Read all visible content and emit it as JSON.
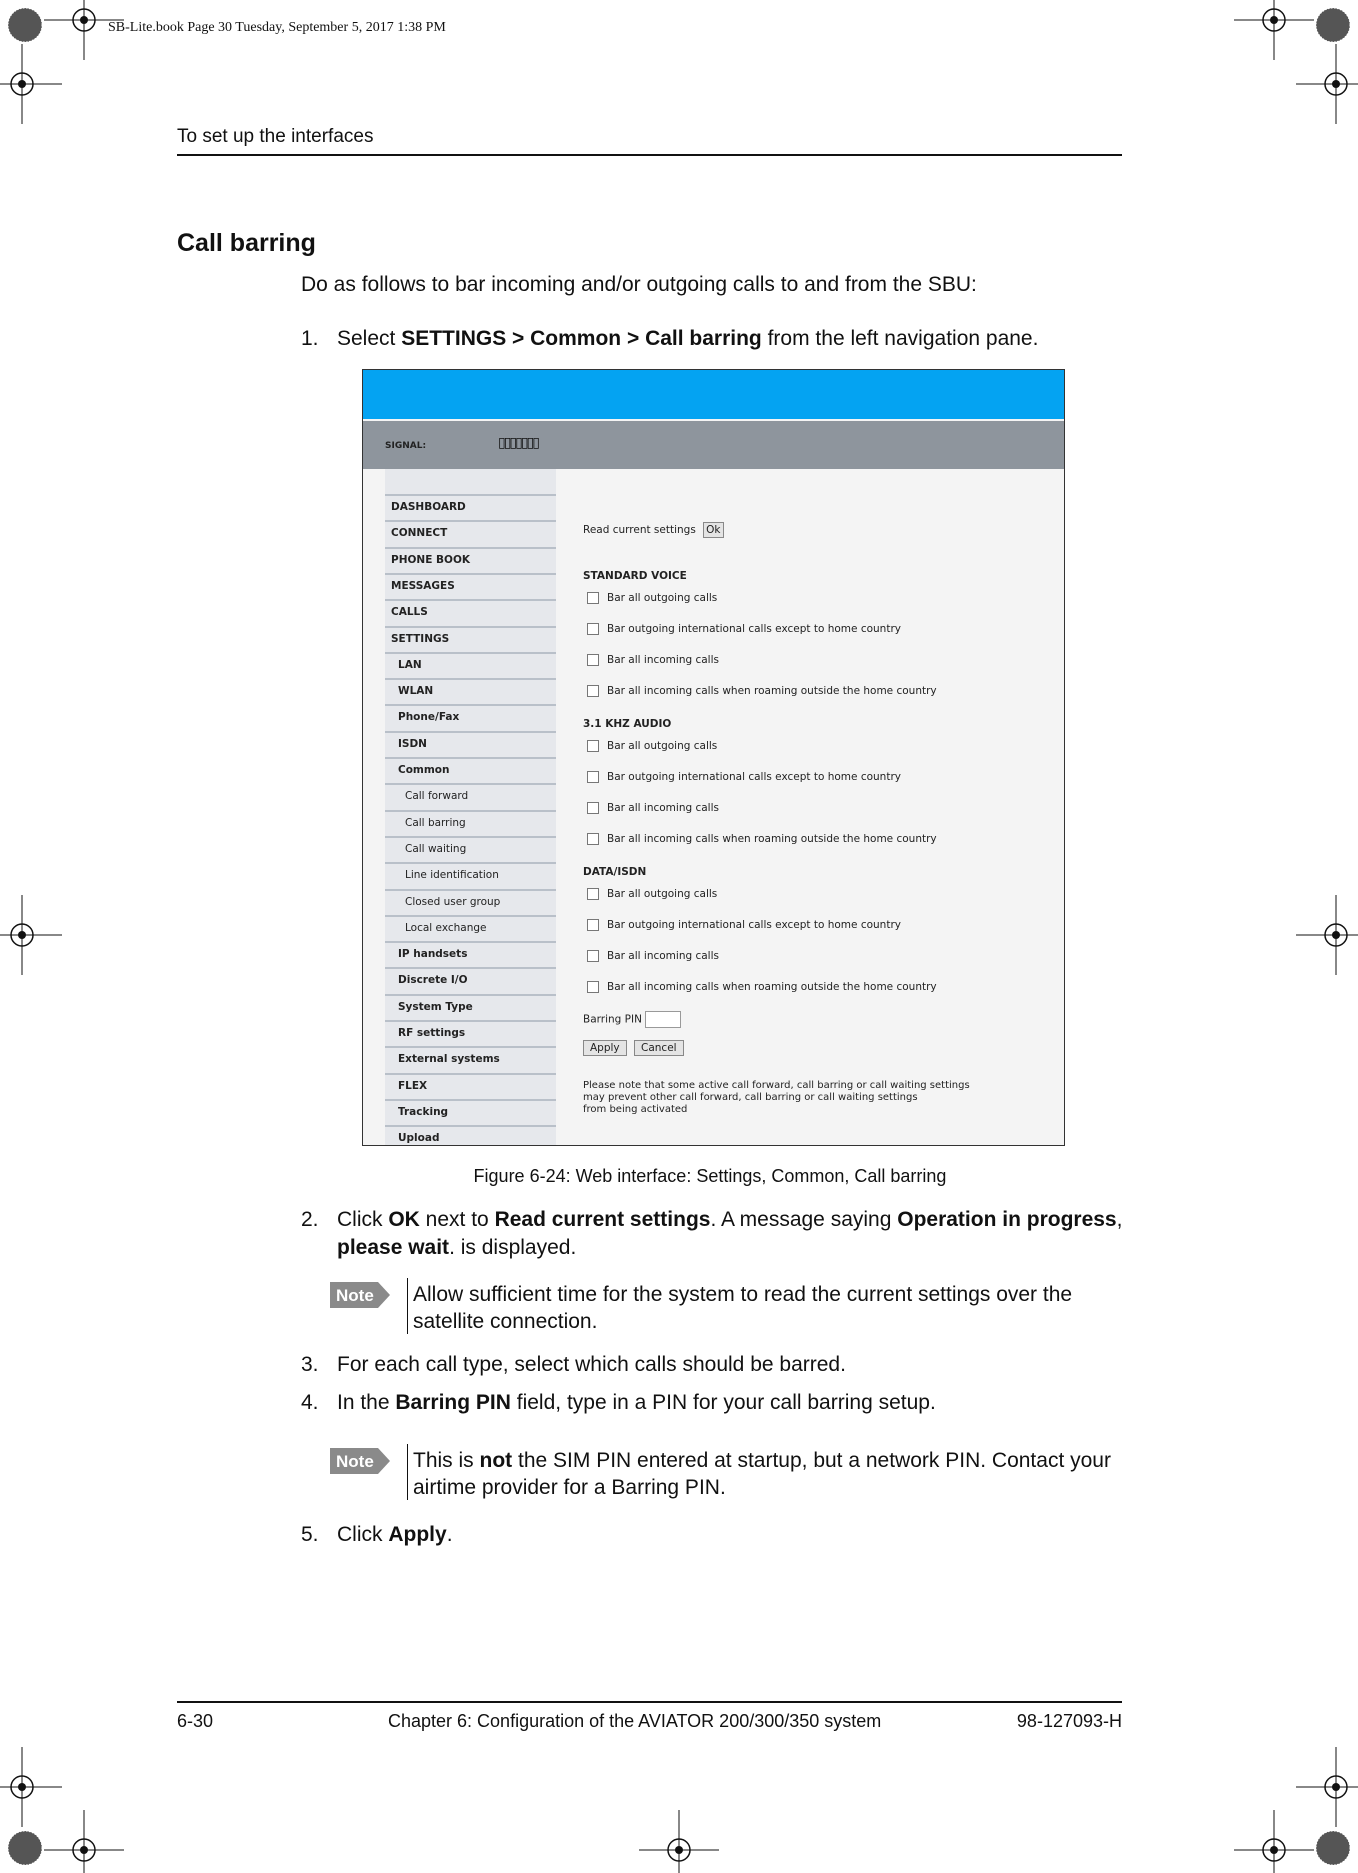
{
  "print_header": "SB-Lite.book  Page 30  Tuesday, September 5, 2017  1:38 PM",
  "running_head": "To set up the interfaces",
  "section_title": "Call barring",
  "intro": "Do as follows to bar incoming and/or outgoing calls to and from the SBU:",
  "steps": {
    "s1": {
      "num": "1.",
      "pre": "Select ",
      "b1": "SETTINGS > Common > Call barring",
      "post": " from the left navigation pane."
    },
    "s2": {
      "num": "2.",
      "pre": "Click ",
      "b1": "OK",
      "mid1": " next to ",
      "b2": "Read current settings",
      "mid2": ". A message saying ",
      "b3": "Operation in progress",
      "mid3": ",",
      "b4": "please wait",
      "post": ". is displayed."
    },
    "s3": {
      "num": "3.",
      "text": "For each call type, select which calls should be barred."
    },
    "s4": {
      "num": "4.",
      "pre": "In the ",
      "b1": "Barring PIN",
      "post": " field, type in a PIN for your call barring setup."
    },
    "s5": {
      "num": "5.",
      "pre": "Click ",
      "b1": "Apply",
      "post": "."
    }
  },
  "notes": {
    "label": "Note",
    "n1": {
      "line1": "Allow sufficient time for the system to read the current settings over the",
      "line2": "satellite connection."
    },
    "n2": {
      "pre": "This is ",
      "b1": "not",
      "post": " the SIM PIN entered at startup, but a network PIN. Contact your",
      "line2": "airtime provider for a Barring PIN."
    }
  },
  "figure": {
    "caption": "Figure 6-24: Web interface: Settings, Common, Call barring",
    "signal_label": "SIGNAL:",
    "signal_bars": "▯▯▯▯▯▯▯",
    "colors": {
      "header": "#04a3f2",
      "statusbar": "#8e959d"
    },
    "nav": [
      {
        "label": "DASHBOARD",
        "level": 0
      },
      {
        "label": "CONNECT",
        "level": 0
      },
      {
        "label": "PHONE BOOK",
        "level": 0
      },
      {
        "label": "MESSAGES",
        "level": 0
      },
      {
        "label": "CALLS",
        "level": 0
      },
      {
        "label": "SETTINGS",
        "level": 0
      },
      {
        "label": "LAN",
        "level": 1
      },
      {
        "label": "WLAN",
        "level": 1
      },
      {
        "label": "Phone/Fax",
        "level": 1
      },
      {
        "label": "ISDN",
        "level": 1
      },
      {
        "label": "Common",
        "level": 1
      },
      {
        "label": "Call forward",
        "level": 2
      },
      {
        "label": "Call barring",
        "level": 2
      },
      {
        "label": "Call waiting",
        "level": 2
      },
      {
        "label": "Line identification",
        "level": 2
      },
      {
        "label": "Closed user group",
        "level": 2
      },
      {
        "label": "Local exchange",
        "level": 2
      },
      {
        "label": "IP handsets",
        "level": 1
      },
      {
        "label": "Discrete I/O",
        "level": 1
      },
      {
        "label": "System Type",
        "level": 1
      },
      {
        "label": "RF settings",
        "level": 1
      },
      {
        "label": "External systems",
        "level": 1
      },
      {
        "label": "FLEX",
        "level": 1
      },
      {
        "label": "Tracking",
        "level": 1
      },
      {
        "label": "Upload",
        "level": 1
      }
    ],
    "read_settings_label": "Read current settings",
    "ok_label": "Ok",
    "sections": [
      {
        "title": "STANDARD VOICE",
        "options": [
          {
            "label": "Bar all outgoing calls",
            "checked": false
          },
          {
            "label": "Bar outgoing international calls except to home country",
            "checked": false
          },
          {
            "label": "Bar all incoming calls",
            "checked": false
          },
          {
            "label": "Bar all incoming calls when roaming outside the home country",
            "checked": false
          }
        ]
      },
      {
        "title": "3.1 KHZ AUDIO",
        "options": [
          {
            "label": "Bar all outgoing calls",
            "checked": false
          },
          {
            "label": "Bar outgoing international calls except to home country",
            "checked": false
          },
          {
            "label": "Bar all incoming calls",
            "checked": false
          },
          {
            "label": "Bar all incoming calls when roaming outside the home country",
            "checked": false
          }
        ]
      },
      {
        "title": "DATA/ISDN",
        "options": [
          {
            "label": "Bar all outgoing calls",
            "checked": false
          },
          {
            "label": "Bar outgoing international calls except to home country",
            "checked": false
          },
          {
            "label": "Bar all incoming calls",
            "checked": false
          },
          {
            "label": "Bar all incoming calls when roaming outside the home country",
            "checked": false
          }
        ]
      }
    ],
    "pin_label": "Barring PIN",
    "pin_value": "",
    "apply_label": "Apply",
    "cancel_label": "Cancel",
    "notice": [
      "Please note that some active call forward, call barring or call waiting settings",
      "may prevent other call forward, call barring or call waiting settings",
      "from being activated"
    ]
  },
  "footer": {
    "page": "6-30",
    "chapter": "Chapter 6:  Configuration of the AVIATOR 200/300/350 system",
    "doc": "98-127093-H"
  }
}
